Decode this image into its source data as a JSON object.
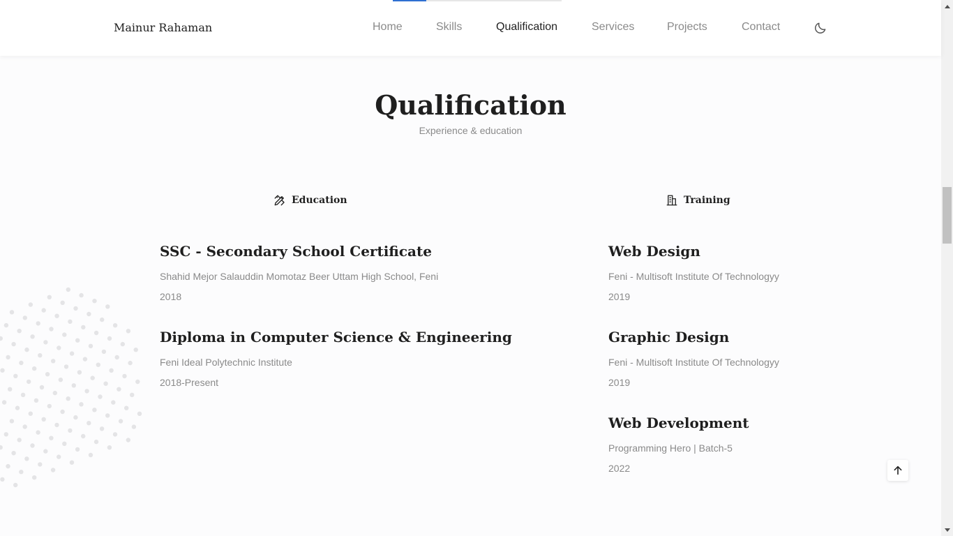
{
  "header": {
    "logo": "Mainur Rahaman",
    "nav": [
      "Home",
      "Skills",
      "Qualification",
      "Services",
      "Projects",
      "Contact"
    ],
    "active_nav": "Qualification",
    "theme_icon": "moon-icon",
    "scroll_progress": 0.2
  },
  "section": {
    "title": "Qualification",
    "subtitle": "Experience & education"
  },
  "tabs": {
    "education": {
      "label": "Education",
      "icon": "education-pen-ruler-icon"
    },
    "training": {
      "label": "Training",
      "icon": "building-icon"
    }
  },
  "education": [
    {
      "title": "SSC - Secondary School Certificate",
      "place": "Shahid Mejor Salauddin Momotaz Beer Uttam High School, Feni",
      "date": "2018"
    },
    {
      "title": "Diploma in Computer Science & Engineering",
      "place": "Feni Ideal Polytechnic Institute",
      "date": "2018-Present"
    }
  ],
  "training": [
    {
      "title": "Web Design",
      "place": "Feni - Multisoft Institute Of Technologyy",
      "date": "2019"
    },
    {
      "title": "Graphic Design",
      "place": "Feni - Multisoft Institute Of Technologyy",
      "date": "2019"
    },
    {
      "title": "Web Development",
      "place": "Programming Hero | Batch-5",
      "date": "2022"
    }
  ],
  "scroll_up_icon": "arrow-up-icon",
  "colors": {
    "accent": "#2f6fd1",
    "text": "#1f1f1f",
    "muted": "#8a8a8a",
    "background": "#fcfcfd"
  }
}
